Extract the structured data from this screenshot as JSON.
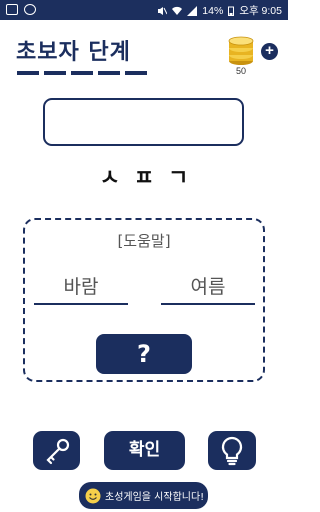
{
  "status_bar": {
    "battery": "14%",
    "time": "오후 9:05"
  },
  "header": {
    "level_title": "초보자 단계",
    "coin_count": "50",
    "add_label": "+"
  },
  "puzzle": {
    "initial_consonants": "ㅅㅍㄱ"
  },
  "hints": {
    "title": "[도움말]",
    "words": [
      "바람",
      "여름"
    ],
    "reveal_button": "?"
  },
  "actions": {
    "confirm_label": "확인"
  },
  "toast": {
    "message": "초성게임을 시작합니다!"
  },
  "colors": {
    "primary": "#1b2e5e",
    "coin": "#e8b422"
  }
}
